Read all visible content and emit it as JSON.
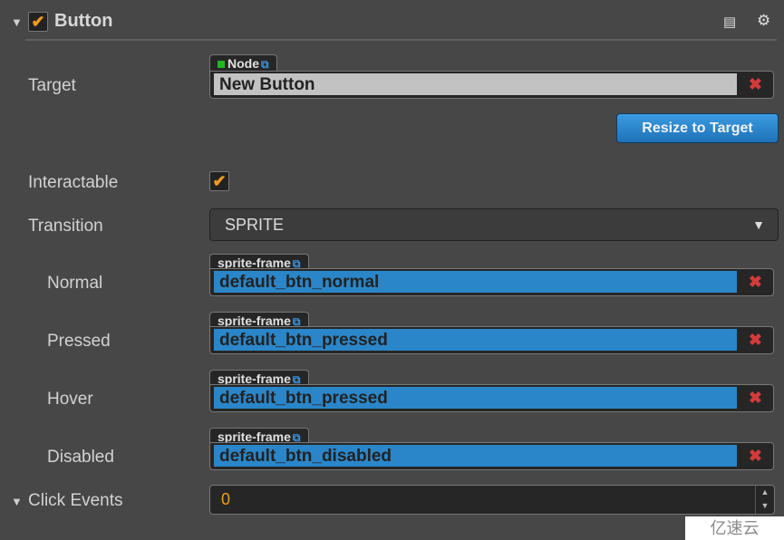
{
  "header": {
    "title": "Button",
    "enabled": true,
    "icons": [
      "book-icon",
      "gear-icon"
    ]
  },
  "target": {
    "label": "Target",
    "type_tag": "Node",
    "value": "New Button"
  },
  "resize_button": "Resize to Target",
  "interactable": {
    "label": "Interactable",
    "checked": true
  },
  "transition": {
    "label": "Transition",
    "value": "SPRITE"
  },
  "sprites": [
    {
      "label": "Normal",
      "type_tag": "sprite-frame",
      "value": "default_btn_normal"
    },
    {
      "label": "Pressed",
      "type_tag": "sprite-frame",
      "value": "default_btn_pressed"
    },
    {
      "label": "Hover",
      "type_tag": "sprite-frame",
      "value": "default_btn_pressed"
    },
    {
      "label": "Disabled",
      "type_tag": "sprite-frame",
      "value": "default_btn_disabled"
    }
  ],
  "click_events": {
    "label": "Click Events",
    "value": "0"
  },
  "watermark": "亿速云",
  "colors": {
    "accent": "#f39c1d",
    "sprite_field": "#2a86c8",
    "remove": "#d53a3a",
    "node_dot": "#1fb81f"
  }
}
